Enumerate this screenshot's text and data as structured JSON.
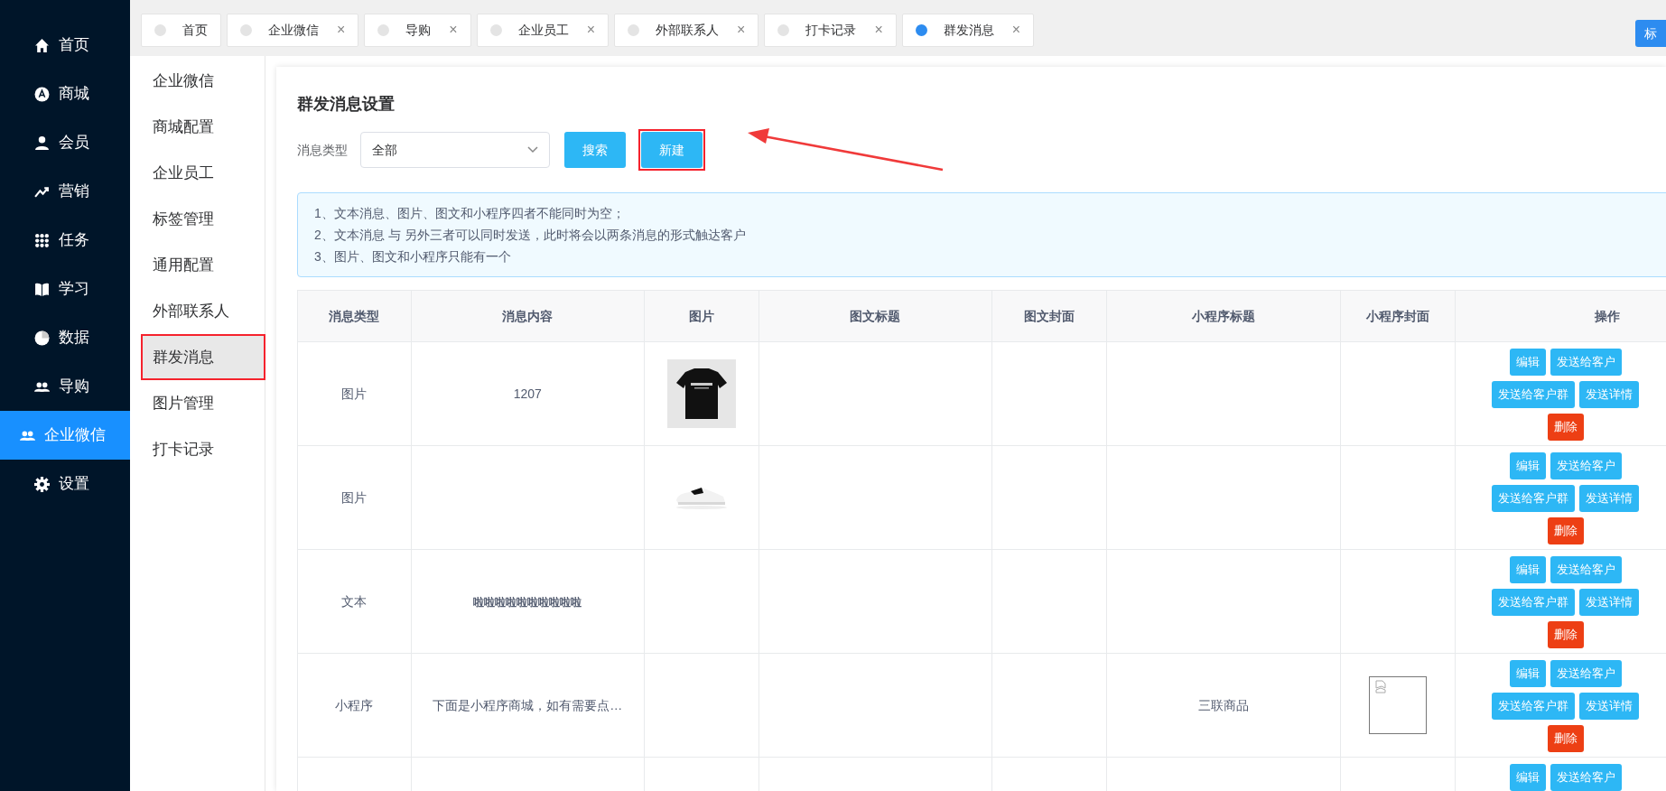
{
  "nav": [
    {
      "label": "首页",
      "kind": "home",
      "selected": false
    },
    {
      "label": "商城",
      "kind": "store",
      "selected": false
    },
    {
      "label": "会员",
      "kind": "person",
      "selected": false
    },
    {
      "label": "营销",
      "kind": "trend",
      "selected": false
    },
    {
      "label": "任务",
      "kind": "grid",
      "selected": false
    },
    {
      "label": "学习",
      "kind": "book",
      "selected": false
    },
    {
      "label": "数据",
      "kind": "pie",
      "selected": false
    },
    {
      "label": "导购",
      "kind": "people",
      "selected": false
    },
    {
      "label": "企业微信",
      "kind": "people",
      "selected": true
    },
    {
      "label": "设置",
      "kind": "gear",
      "selected": false
    }
  ],
  "submenu": [
    {
      "label": "企业微信",
      "selected": false,
      "highlighted": false
    },
    {
      "label": "商城配置",
      "selected": false,
      "highlighted": false
    },
    {
      "label": "企业员工",
      "selected": false,
      "highlighted": false
    },
    {
      "label": "标签管理",
      "selected": false,
      "highlighted": false
    },
    {
      "label": "通用配置",
      "selected": false,
      "highlighted": false
    },
    {
      "label": "外部联系人",
      "selected": false,
      "highlighted": false
    },
    {
      "label": "群发消息",
      "selected": true,
      "highlighted": true
    },
    {
      "label": "图片管理",
      "selected": false,
      "highlighted": false
    },
    {
      "label": "打卡记录",
      "selected": false,
      "highlighted": false
    }
  ],
  "tabs": [
    {
      "label": "首页",
      "selected": false,
      "closable": false
    },
    {
      "label": "企业微信",
      "selected": false,
      "closable": true
    },
    {
      "label": "导购",
      "selected": false,
      "closable": true
    },
    {
      "label": "企业员工",
      "selected": false,
      "closable": true
    },
    {
      "label": "外部联系人",
      "selected": false,
      "closable": true
    },
    {
      "label": "打卡记录",
      "selected": false,
      "closable": true
    },
    {
      "label": "群发消息",
      "selected": true,
      "closable": true
    }
  ],
  "tab_close": "×",
  "tag_button": "标",
  "panel": {
    "title": "群发消息设置",
    "filter_label": "消息类型",
    "select_value": "全部",
    "search_button": "搜索",
    "new_button": "新建",
    "new_highlighted": true,
    "annotation_arrow": true
  },
  "notices": [
    "1、文本消息、图片、图文和小程序四者不能同时为空；",
    "2、文本消息 与 另外三者可以同时发送，此时将会以两条消息的形式触达客户",
    "3、图片、图文和小程序只能有一个"
  ],
  "table": {
    "columns": [
      "消息类型",
      "消息内容",
      "图片",
      "图文标题",
      "图文封面",
      "小程序标题",
      "小程序封面",
      "操作"
    ],
    "rows": [
      {
        "cells": [
          {
            "kind": "text",
            "text": "图片"
          },
          {
            "kind": "text",
            "text": "1207"
          },
          {
            "kind": "picture"
          },
          {
            "kind": "empty"
          },
          {
            "kind": "empty"
          },
          {
            "kind": "empty"
          },
          {
            "kind": "empty"
          }
        ],
        "actions": [
          {
            "label": "编辑",
            "kind": "primary"
          },
          {
            "label": "发送给客户",
            "kind": "primary"
          },
          {
            "label": "发送给客户群",
            "kind": "primary"
          },
          {
            "label": "发送详情",
            "kind": "primary"
          },
          {
            "label": "删除",
            "kind": "danger"
          }
        ]
      },
      {
        "cells": [
          {
            "kind": "text",
            "text": "图片"
          },
          {
            "kind": "empty"
          },
          {
            "kind": "picture"
          },
          {
            "kind": "empty"
          },
          {
            "kind": "empty"
          },
          {
            "kind": "empty"
          },
          {
            "kind": "empty"
          }
        ],
        "actions": [
          {
            "label": "编辑",
            "kind": "primary"
          },
          {
            "label": "发送给客户",
            "kind": "primary"
          },
          {
            "label": "发送给客户群",
            "kind": "primary"
          },
          {
            "label": "发送详情",
            "kind": "primary"
          },
          {
            "label": "删除",
            "kind": "danger"
          }
        ]
      },
      {
        "cells": [
          {
            "kind": "text",
            "text": "文本"
          },
          {
            "kind": "text",
            "text": "啦啦啦啦啦啦啦啦啦啦",
            "bold": true
          },
          {
            "kind": "empty"
          },
          {
            "kind": "empty"
          },
          {
            "kind": "empty"
          },
          {
            "kind": "empty"
          },
          {
            "kind": "empty"
          }
        ],
        "actions": [
          {
            "label": "编辑",
            "kind": "primary"
          },
          {
            "label": "发送给客户",
            "kind": "primary"
          },
          {
            "label": "发送给客户群",
            "kind": "primary"
          },
          {
            "label": "发送详情",
            "kind": "primary"
          },
          {
            "label": "删除",
            "kind": "danger"
          }
        ]
      },
      {
        "cells": [
          {
            "kind": "text",
            "text": "小程序"
          },
          {
            "kind": "text",
            "text": "下面是小程序商城，如有需要点…"
          },
          {
            "kind": "empty"
          },
          {
            "kind": "empty"
          },
          {
            "kind": "empty"
          },
          {
            "kind": "text",
            "text": "三联商品"
          },
          {
            "kind": "broken-image"
          }
        ],
        "actions": [
          {
            "label": "编辑",
            "kind": "primary"
          },
          {
            "label": "发送给客户",
            "kind": "primary"
          },
          {
            "label": "发送给客户群",
            "kind": "primary"
          },
          {
            "label": "发送详情",
            "kind": "primary"
          },
          {
            "label": "删除",
            "kind": "danger"
          }
        ]
      },
      {
        "cells": [
          {
            "kind": "empty"
          },
          {
            "kind": "empty"
          },
          {
            "kind": "empty"
          },
          {
            "kind": "empty"
          },
          {
            "kind": "empty"
          },
          {
            "kind": "empty"
          },
          {
            "kind": "empty"
          }
        ],
        "actions": [
          {
            "label": "编辑",
            "kind": "primary"
          },
          {
            "label": "发送给客户",
            "kind": "primary"
          }
        ]
      }
    ]
  }
}
